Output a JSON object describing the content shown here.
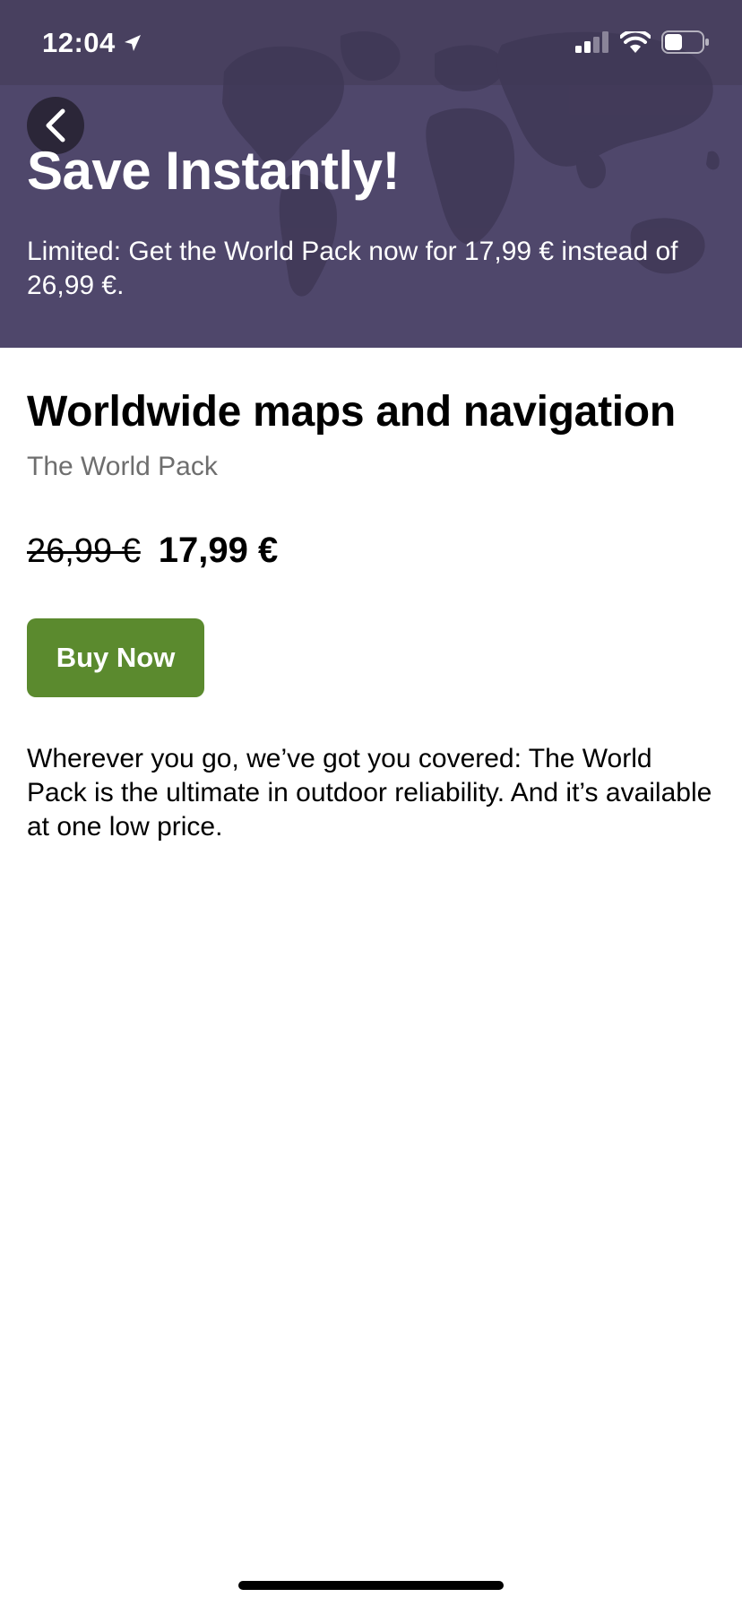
{
  "status_bar": {
    "time": "12:04",
    "location_icon": "location-arrow-icon",
    "signal_icon": "cellular-signal-icon",
    "wifi_icon": "wifi-icon",
    "battery_icon": "battery-icon"
  },
  "hero": {
    "back_icon": "chevron-left-icon",
    "title": "Save Instantly!",
    "subtitle": "Limited: Get the World Pack now for 17,99 € instead of 26,99 €.",
    "background_color": "#4f476b"
  },
  "product": {
    "title": "Worldwide maps and navigation",
    "subtitle": "The World Pack",
    "old_price": "26,99 €",
    "new_price": "17,99 €",
    "buy_label": "Buy Now",
    "buy_color": "#5b8a2e",
    "description": "Wherever you go, we’ve got you covered: The World Pack is the ultimate in outdoor reliability. And it’s available at one low price."
  }
}
